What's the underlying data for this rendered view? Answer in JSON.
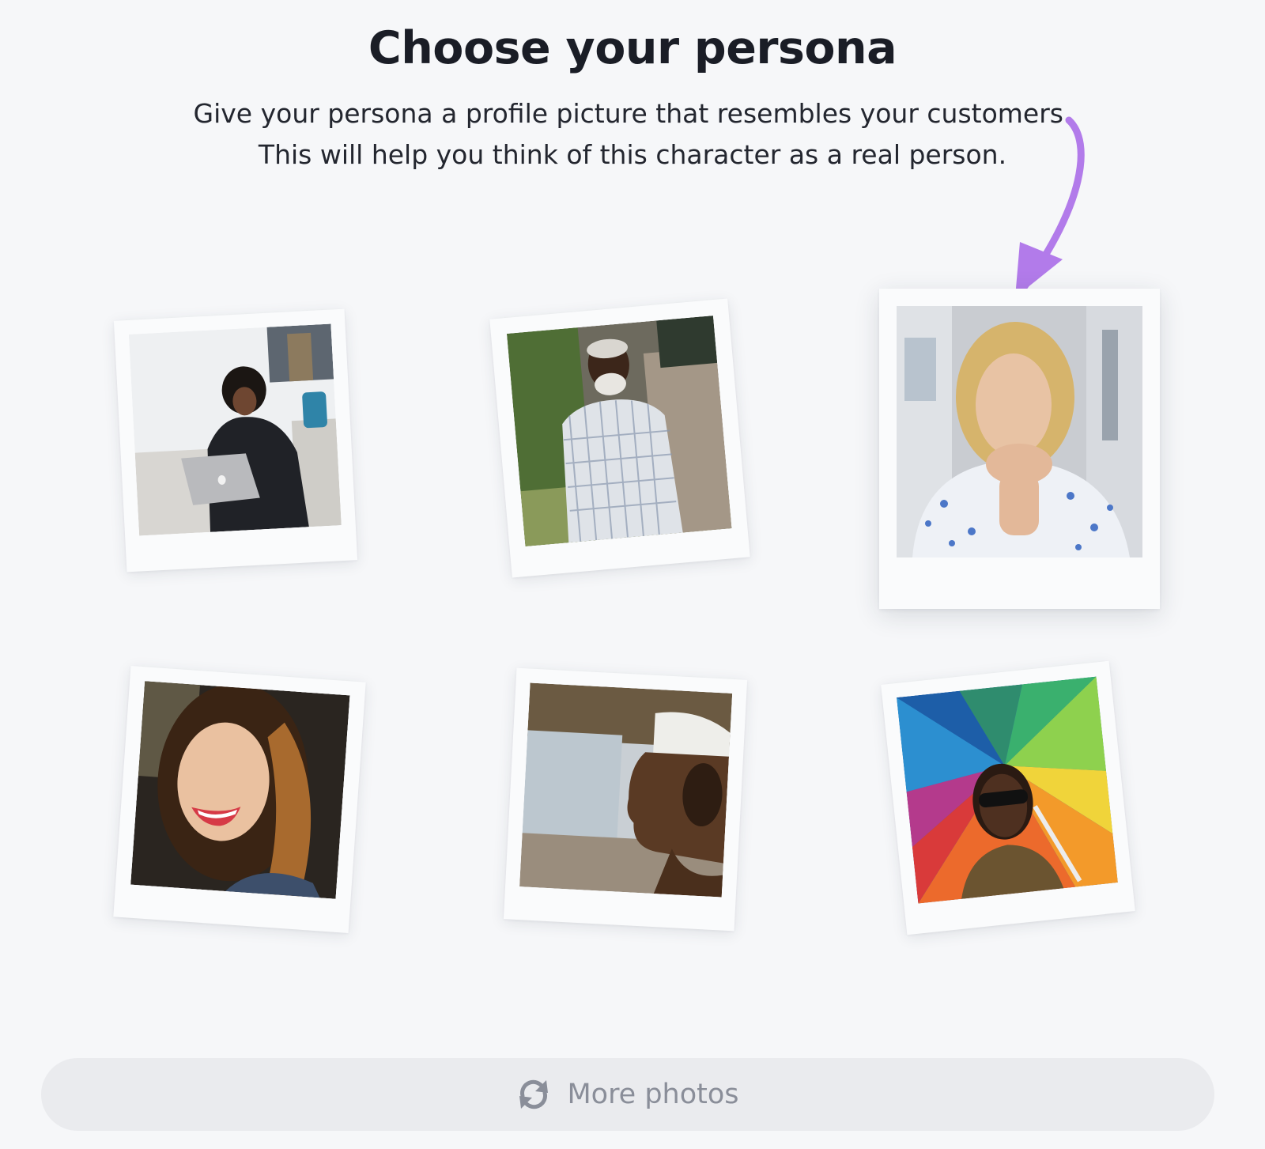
{
  "header": {
    "title": "Choose your persona",
    "subtitle_line1": "Give your persona a profile picture that resembles your customers.",
    "subtitle_line2": "This will help you think of this character as a real person."
  },
  "photos": [
    {
      "subject": "woman with laptop on sofa"
    },
    {
      "subject": "older man in plaid shirt outdoors"
    },
    {
      "subject": "blonde woman resting chin on hands",
      "selected": true
    },
    {
      "subject": "smiling young woman with long hair"
    },
    {
      "subject": "man in profile wearing white cap"
    },
    {
      "subject": "person with sunglasses under rainbow umbrella"
    }
  ],
  "more_button": {
    "label": "More photos",
    "icon": "refresh-icon"
  },
  "colors": {
    "background": "#f6f7f9",
    "title": "#1a1d26",
    "arrow": "#b27bea",
    "button_bg": "#eaebee",
    "button_text": "#8a8e99"
  }
}
